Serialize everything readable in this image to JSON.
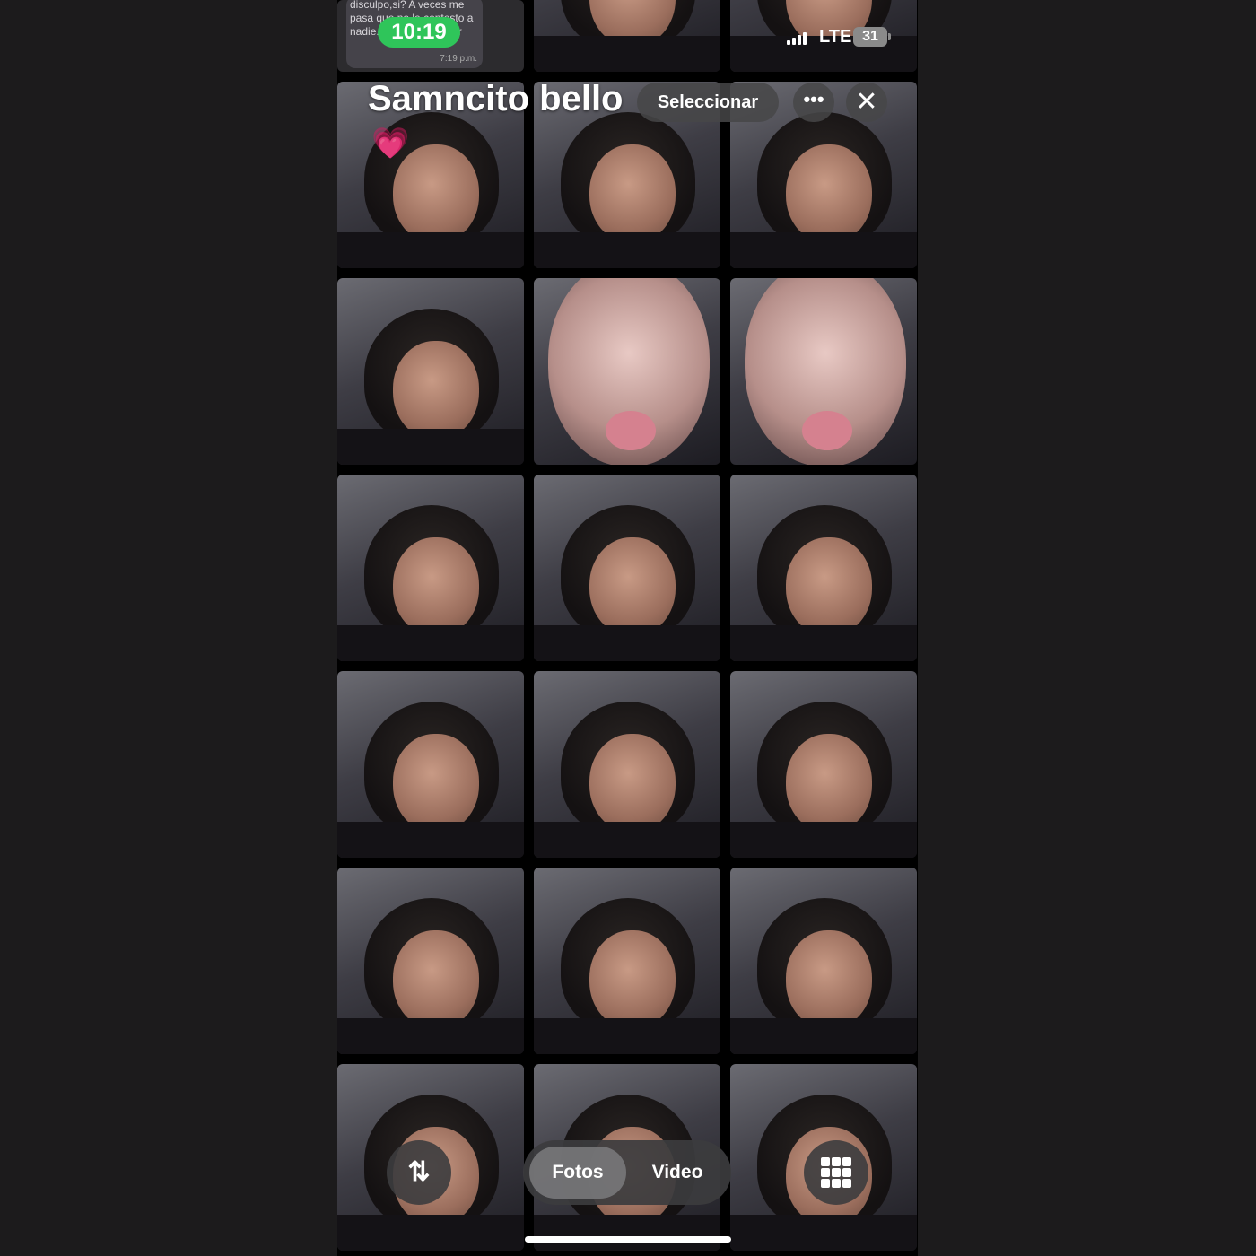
{
  "status_bar": {
    "time": "10:19",
    "network": "LTE",
    "battery": "31"
  },
  "header": {
    "title": "Samncito bello",
    "title_emoji": "💗",
    "select_label": "Seleccionar",
    "more_label": "•••",
    "close_label": "✕"
  },
  "chat_preview": {
    "text": "disculpo,si? A veces me pasa que no le contesto a nadie... o solo no... ular",
    "time": "7:19 p.m."
  },
  "toolbar": {
    "sort_label": "⇅",
    "segments": [
      {
        "label": "Fotos",
        "selected": true
      },
      {
        "label": "Video",
        "selected": false
      }
    ],
    "grid_icon": "grid-icon"
  },
  "colors": {
    "time_pill": "#2fc55a",
    "background": "#000000"
  }
}
